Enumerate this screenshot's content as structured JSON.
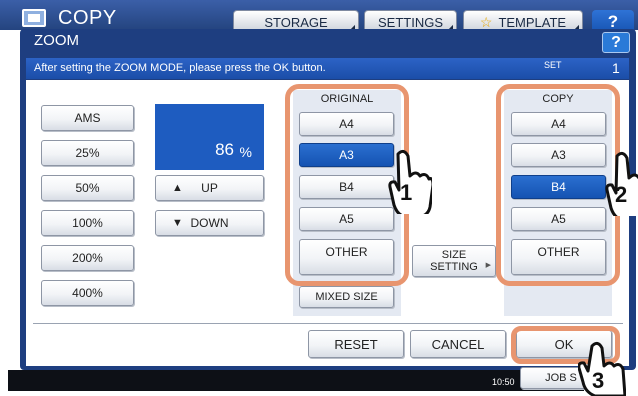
{
  "app": {
    "title": "COPY",
    "top_buttons": {
      "storage": "STORAGE",
      "settings": "SETTINGS",
      "template": "TEMPLATE"
    },
    "help": "?"
  },
  "dialog": {
    "title": "ZOOM",
    "help": "?",
    "message": "After setting the ZOOM MODE, please press the OK button.",
    "set_label": "SET",
    "set_number": "1"
  },
  "zoom": {
    "presets": [
      "AMS",
      "25%",
      "50%",
      "100%",
      "200%",
      "400%"
    ],
    "value": "86",
    "unit": "%",
    "up_label": "UP",
    "down_label": "DOWN"
  },
  "original": {
    "label": "ORIGINAL",
    "sizes": [
      "A4",
      "A3",
      "B4",
      "A5",
      "OTHER"
    ],
    "selected": "A3",
    "mixed_size": "MIXED SIZE"
  },
  "size_setting": {
    "line1": "SIZE",
    "line2": "SETTING"
  },
  "copy": {
    "label": "COPY",
    "sizes": [
      "A4",
      "A3",
      "B4",
      "A5",
      "OTHER"
    ],
    "selected": "B4"
  },
  "actions": {
    "reset": "RESET",
    "cancel": "CANCEL",
    "ok": "OK"
  },
  "status": {
    "clock": "10:50",
    "job_status": "JOB S"
  },
  "callouts": {
    "step1": "1",
    "step2": "2",
    "step3": "3"
  },
  "colors": {
    "accent": "#1553b2",
    "callout": "#e8956f",
    "panel": "#e4e9f2"
  },
  "icons": {
    "up": "up-triangle-icon",
    "down": "down-triangle-icon",
    "star": "star-icon",
    "hand": "hand-pointer-icon"
  }
}
